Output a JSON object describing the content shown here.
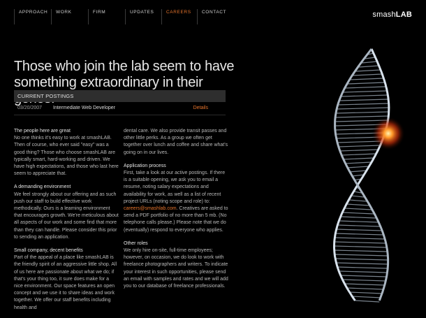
{
  "nav": [
    "APPROACH",
    "WORK",
    "FIRM",
    "UPDATES",
    "CAREERS",
    "CONTACT"
  ],
  "logo": {
    "light": "smash",
    "bold": "LAB"
  },
  "headline": "Those who join the lab seem to have something extraordinary in their genes.",
  "postings": {
    "header": "CURRENT POSTINGS",
    "rows": [
      {
        "date": "03/20/2007",
        "title": "Intermediate Web Developer",
        "link": "Details"
      }
    ]
  },
  "left_col": {
    "s1_title": "The people here are great",
    "s1_body": "No one thinks it's easy to work at smashLAB. Then of course, who ever said \"easy\" was a good thing? Those who choose smashLAB are typically smart, hard-working and driven. We have high expectations, and those who last here seem to appreciate that.",
    "s2_title": "A demanding environment",
    "s2_body": "We feel strongly about our offering and as such push our staff to build effective work methodically. Ours is a learning environment that encourages growth. We're meticulous about all aspects of our work and some find that more than they can handle. Please consider this prior to sending an application.",
    "s3_title": "Small company, decent benefits",
    "s3_body": "Part of the appeal of a place like smashLAB is the friendly spirit of an aggressive little shop. All of us here are passionate about what we do; if that's your thing too, it sure does make for a nice environment. Our space features an open concept and we use it to share ideas and work together. We offer our staff benefits including health and"
  },
  "right_col": {
    "s0_body": "dental care. We also provide transit passes and other little perks. As a group we often get together over lunch and coffee and share what's going on in our lives.",
    "s1_title": "Application process",
    "s1_body_a": "First, take a look at our active postings. If there is a suitable opening, we ask you to email a resume, noting salary expectations and availability for work, as well as a list of recent project URLs (noting scope and role) to:",
    "s1_email": "careers@smashlab.com",
    "s1_body_b": ". Creatives are asked to send a PDF portfolio of no more than 5 mb. (No telephone calls please.) Please note that we do (eventually) respond to everyone who applies.",
    "s2_title": "Other roles",
    "s2_body": "We only hire on-site, full-time employees; however, on occasion, we do look to work with freelance photographers and writers. To indicate your interest in such opportunities, please send an email with samples and rates and we will add you to our database of freelance professionals."
  }
}
